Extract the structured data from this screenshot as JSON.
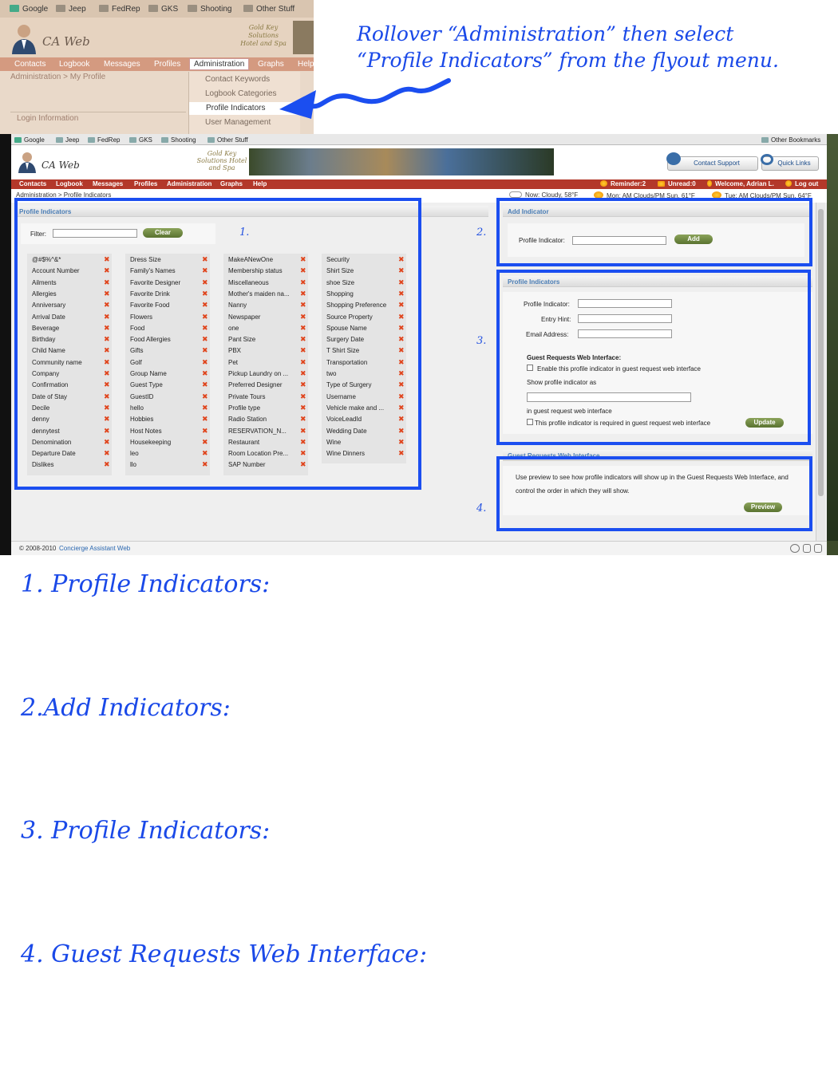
{
  "zoom": {
    "bookmarks": [
      "Google",
      "Jeep",
      "FedRep",
      "GKS",
      "Shooting",
      "Other Stuff"
    ],
    "app_title": "CA Web",
    "brand": "Gold Key Solutions Hotel and Spa",
    "nav": [
      "Contacts",
      "Logbook",
      "Messages",
      "Profiles",
      "Administration",
      "Graphs",
      "Help"
    ],
    "breadcrumb": "Administration > My Profile",
    "menu": [
      "Contact Keywords",
      "Logbook Categories",
      "Profile Indicators",
      "User Management"
    ],
    "login_label": "Login Information"
  },
  "instruction": {
    "line1": "Rollover “Administration” then select",
    "line2": "“Profile Indicators” from the flyout menu."
  },
  "app": {
    "bookmarks": [
      "Google",
      "Jeep",
      "FedRep",
      "GKS",
      "Shooting",
      "Other Stuff"
    ],
    "other_bookmarks": "Other Bookmarks",
    "app_title": "CA Web",
    "brand": "Gold Key Solutions Hotel and Spa",
    "contact_support": "Contact Support",
    "quick_links": "Quick Links",
    "nav": [
      "Contacts",
      "Logbook",
      "Messages",
      "Profiles",
      "Administration",
      "Graphs",
      "Help"
    ],
    "status": {
      "reminder": "Reminder:2",
      "unread": "Unread:0",
      "welcome": "Welcome, Adrian L.",
      "logout": "Log out"
    },
    "breadcrumb": "Administration > Profile Indicators",
    "weather": {
      "now": "Now: Cloudy, 58°F",
      "mon": "Mon: AM Clouds/PM Sun, 61°F",
      "tue": "Tue: AM Clouds/PM Sun, 64°F"
    },
    "left_panel": {
      "title": "Profile Indicators",
      "filter_label": "Filter:",
      "clear": "Clear",
      "columns": [
        [
          "@#$%^&*",
          "Account Number",
          "Ailments",
          "Allergies",
          "Anniversary",
          "Arrival Date",
          "Beverage",
          "Birthday",
          "Child Name",
          "Community name",
          "Company",
          "Confirmation",
          "Date of Stay",
          "Decile",
          "denny",
          "dennytest",
          "Denomination",
          "Departure Date",
          "Dislikes"
        ],
        [
          "Dress Size",
          "Family's Names",
          "Favorite Designer",
          "Favorite Drink",
          "Favorite Food",
          "Flowers",
          "Food",
          "Food Allergies",
          "Gifts",
          "Golf",
          "Group Name",
          "Guest Type",
          "GuestID",
          "hello",
          "Hobbies",
          "Host Notes",
          "Housekeeping",
          "leo",
          "llo"
        ],
        [
          "MakeANewOne",
          "Membership status",
          "Miscellaneous",
          "Mother's maiden na...",
          "Nanny",
          "Newspaper",
          "one",
          "Pant Size",
          "PBX",
          "Pet",
          "Pickup Laundry on ...",
          "Preferred Designer",
          "Private Tours",
          "Profile type",
          "Radio Station",
          "RESERVATION_N...",
          "Restaurant",
          "Room Location Pre...",
          "SAP Number"
        ],
        [
          "Security",
          "Shirt Size",
          "shoe Size",
          "Shopping",
          "Shopping Preference",
          "Source Property",
          "Spouse Name",
          "Surgery Date",
          "T Shirt Size",
          "Transportation",
          "two",
          "Type of Surgery",
          "Username",
          "Vehicle make and ...",
          "VoiceLeadId",
          "Wedding Date",
          "Wine",
          "Wine Dinners"
        ]
      ]
    },
    "add_panel": {
      "title": "Add Indicator",
      "label": "Profile Indicator:",
      "button": "Add"
    },
    "edit_panel": {
      "title": "Profile Indicators",
      "profile_indicator": "Profile Indicator:",
      "entry_hint": "Entry Hint:",
      "email_address": "Email Address:",
      "gri_heading": "Guest Requests Web Interface:",
      "enable_label": "Enable this profile indicator in guest request web interface",
      "show_as": "Show profile indicator as",
      "in_gri": "in guest request web interface",
      "required_label": "This profile indicator is required in guest request web interface",
      "update": "Update"
    },
    "gri_panel": {
      "title": "Guest Requests Web Interface",
      "line1": "Use preview to see how profile indicators will show up in the Guest Requests Web Interface, and",
      "line2": "control the order in which they will show.",
      "preview": "Preview"
    },
    "markers": [
      "1.",
      "2.",
      "3.",
      "4."
    ],
    "footer": {
      "copyright": "© 2008-2010",
      "link": "Concierge Assistant Web"
    }
  },
  "headings": [
    "1. Profile Indicators:",
    "2.Add Indicators:",
    "3. Profile Indicators:",
    "4. Guest Requests Web Interface:"
  ],
  "colors": {
    "annotation_blue": "#1b4ef0",
    "nav_red": "#b3382a",
    "delete_x": "#e0441c",
    "button_green": "#6b8540"
  }
}
